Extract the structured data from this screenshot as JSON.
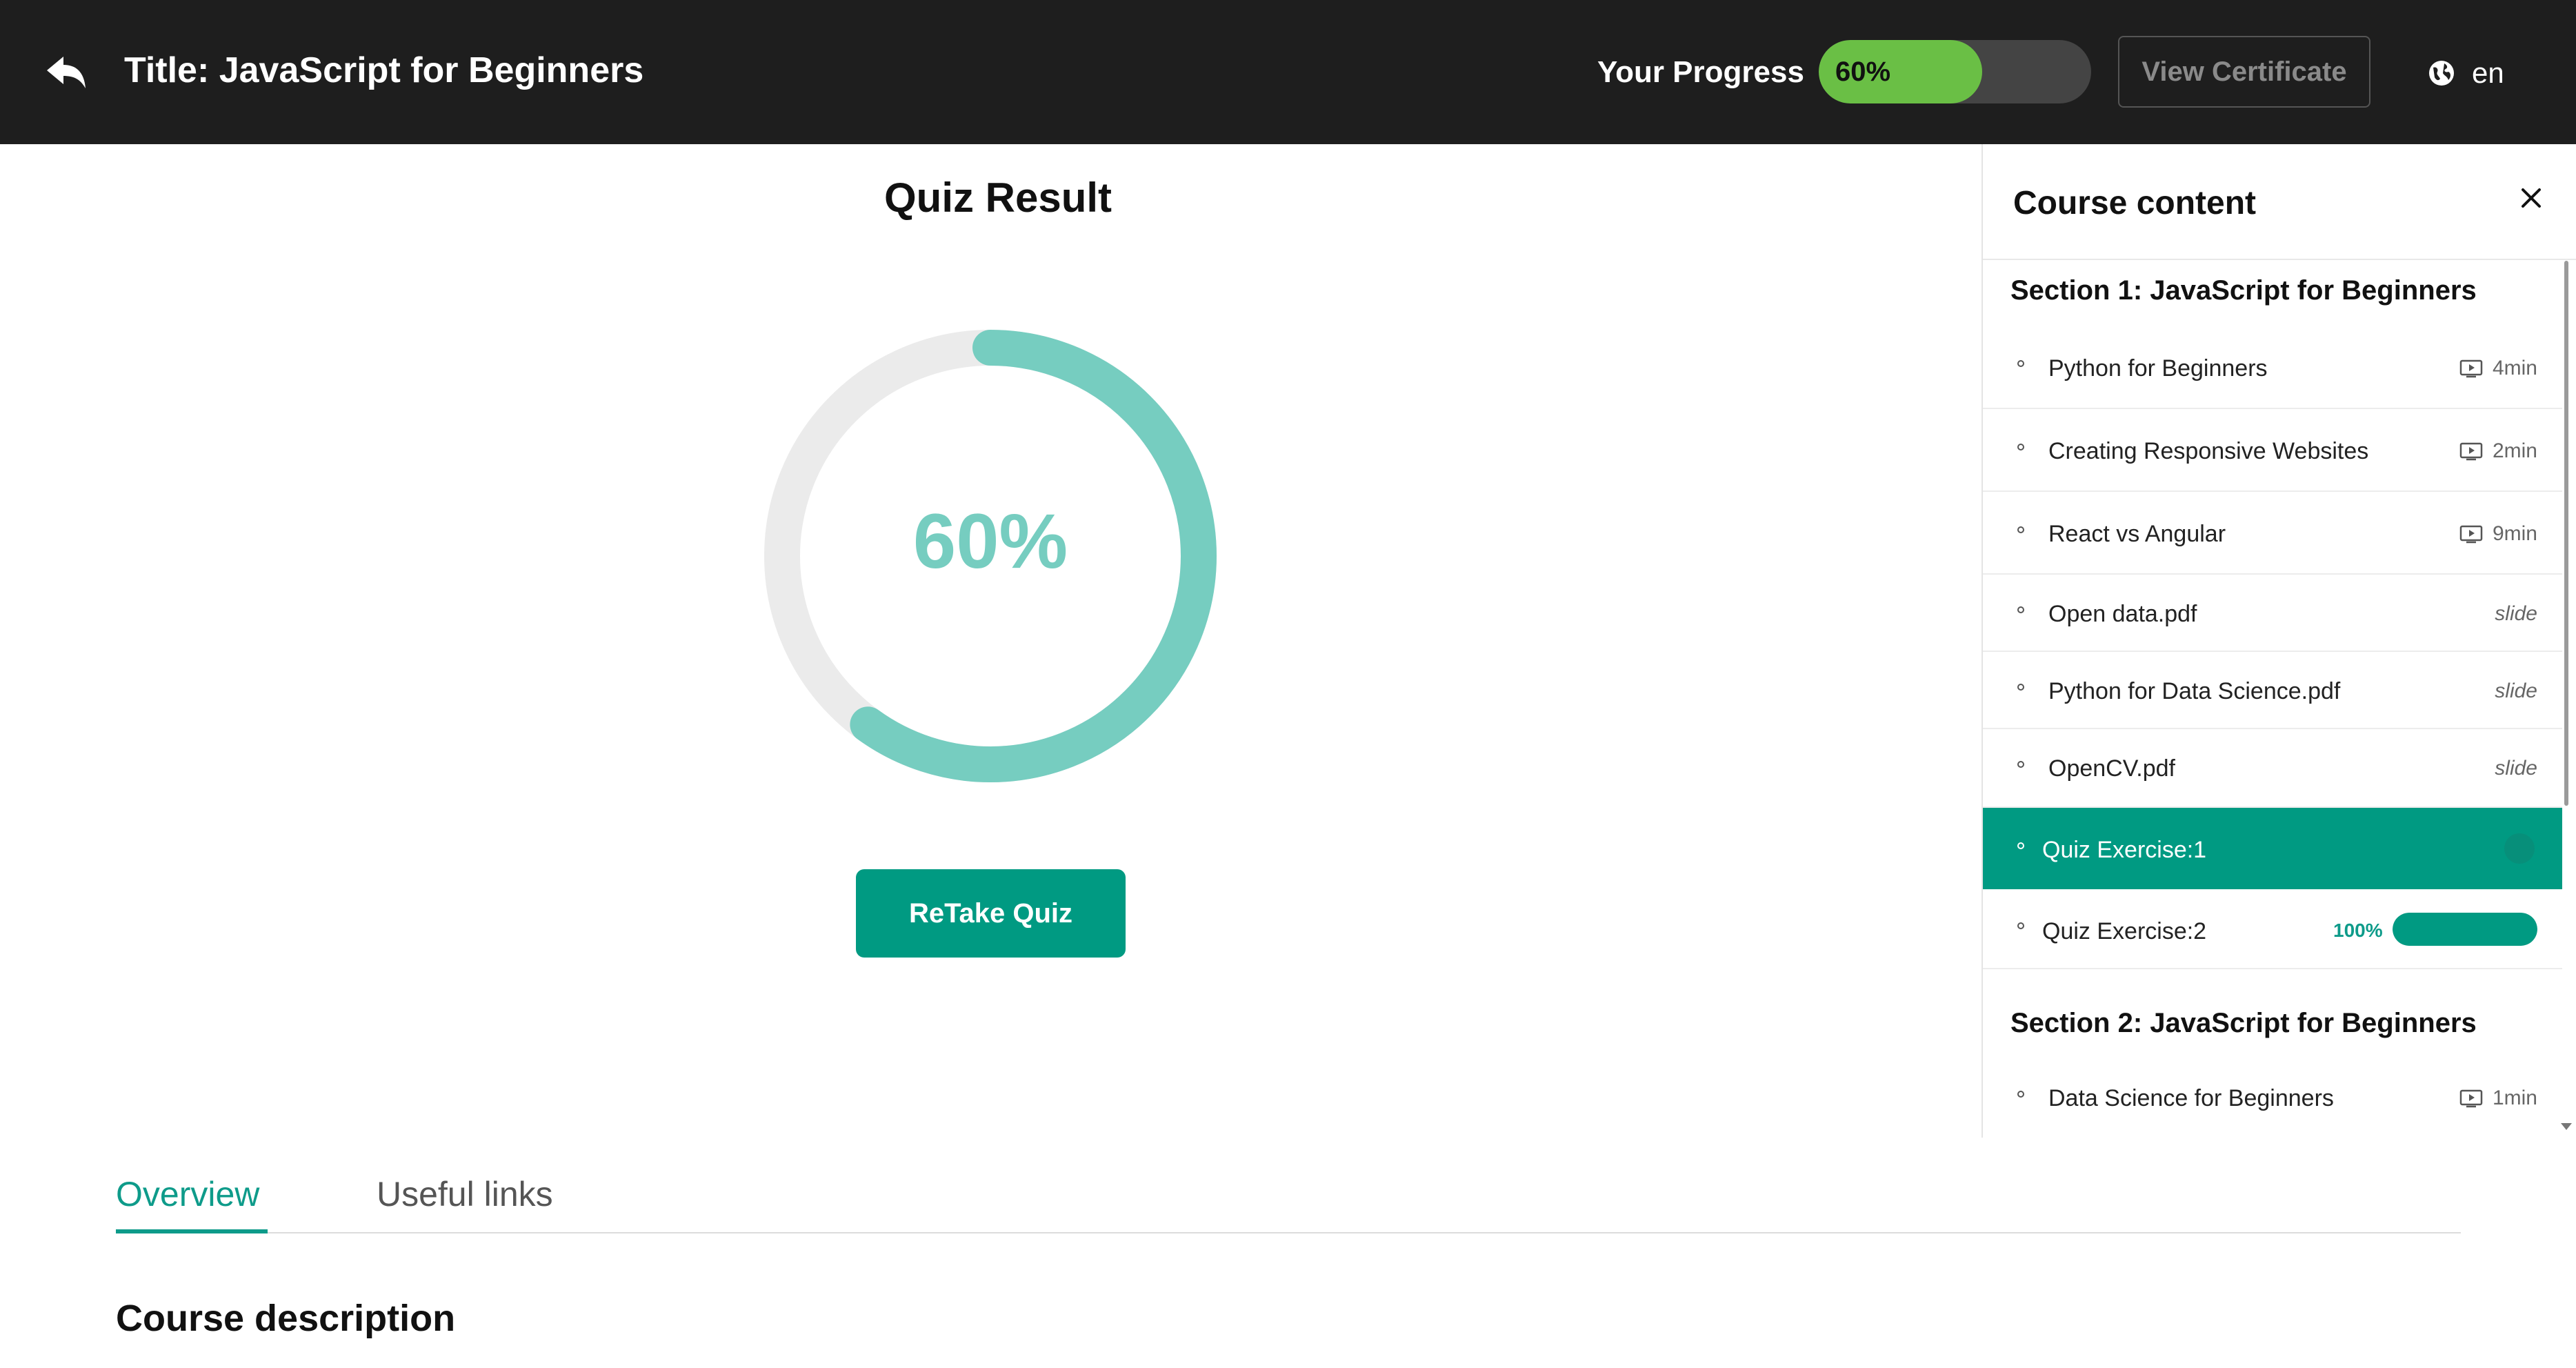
{
  "header": {
    "title": "Title: JavaScript for Beginners",
    "progress_label": "Your Progress",
    "progress_value": 60,
    "progress_text": "60%",
    "certificate_button": "View Certificate",
    "language": "en",
    "icons": {
      "back": "reply-arrow-icon",
      "language": "globe-icon"
    }
  },
  "quiz": {
    "title": "Quiz Result",
    "score_percent": 60,
    "score_text": "60%",
    "retake_button": "ReTake Quiz"
  },
  "tabs": [
    {
      "label": "Overview",
      "active": true
    },
    {
      "label": "Useful links",
      "active": false
    }
  ],
  "main": {
    "description_title": "Course description"
  },
  "sidebar": {
    "title": "Course content",
    "close_icon": "close-icon",
    "sections": [
      {
        "title": "Section 1: JavaScript for Beginners",
        "items": [
          {
            "label": "Python for Beginners",
            "duration": "4min",
            "type": "video"
          },
          {
            "label": "Creating Responsive Websites",
            "duration": "2min",
            "type": "video"
          },
          {
            "label": "React vs Angular",
            "duration": "9min",
            "type": "video"
          },
          {
            "label": "Open data.pdf",
            "kind": "slide",
            "type": "slide"
          },
          {
            "label": "Python for Data Science.pdf",
            "kind": "slide",
            "type": "slide"
          },
          {
            "label": "OpenCV.pdf",
            "kind": "slide",
            "type": "slide"
          },
          {
            "label": "Quiz Exercise:1",
            "type": "quiz",
            "active": true
          },
          {
            "label": "Quiz Exercise:2",
            "type": "quiz",
            "progress_text": "100%",
            "progress_value": 100
          }
        ]
      },
      {
        "title": "Section 2: JavaScript for Beginners",
        "items": [
          {
            "label": "Data Science for Beginners",
            "duration": "1min",
            "type": "video"
          }
        ]
      }
    ]
  },
  "colors": {
    "header_bg": "#1e1e1e",
    "progress_green": "#6abf45",
    "teal": "#009a82",
    "ring_teal": "#76cdc0",
    "ring_track": "#ebebeb"
  }
}
